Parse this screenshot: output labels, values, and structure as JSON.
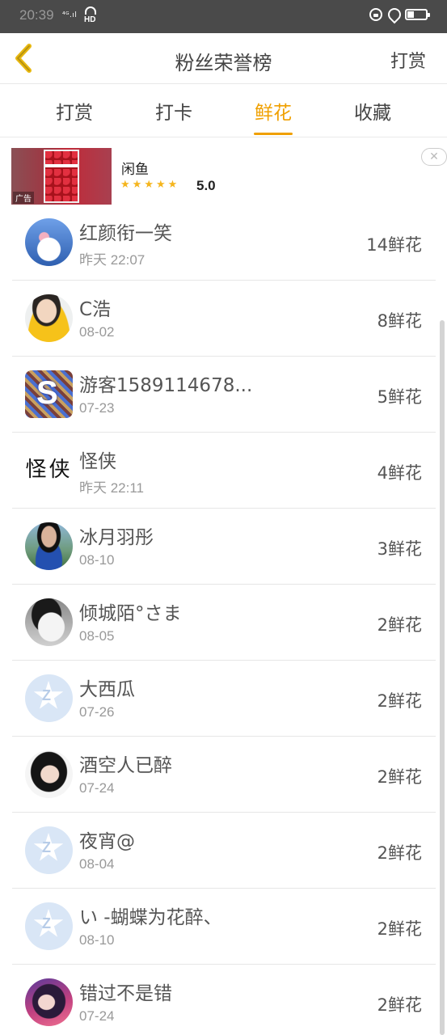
{
  "status_bar": {
    "time": "20:39",
    "signal": "⁴ᴳ.ıl",
    "hd": "HD"
  },
  "header": {
    "title": "粉丝荣誉榜",
    "right_action": "打赏"
  },
  "tabs": [
    {
      "label": "打赏",
      "active": false
    },
    {
      "label": "打卡",
      "active": false
    },
    {
      "label": "鲜花",
      "active": true
    },
    {
      "label": "收藏",
      "active": false
    }
  ],
  "ad": {
    "label": "广告",
    "app_name": "闲鱼",
    "rating": "5.0",
    "stars": 5,
    "close": "✕"
  },
  "fans": [
    {
      "name": "红颜衔一笑",
      "time": "昨天 22:07",
      "count": "14鲜花",
      "avatar": "plush-toy-avatar"
    },
    {
      "name": "C浩",
      "time": "08-02",
      "count": "8鲜花",
      "avatar": "photo-avatar"
    },
    {
      "name": "游客1589114678...",
      "time": "07-23",
      "count": "5鲜花",
      "avatar": "pixel-avatar"
    },
    {
      "name": "怪侠",
      "time": "昨天 22:11",
      "count": "4鲜花",
      "avatar": "calligraphy-avatar",
      "avatar_text": "怪侠"
    },
    {
      "name": "冰月羽彤",
      "time": "08-10",
      "count": "3鲜花",
      "avatar": "photo-avatar"
    },
    {
      "name": "倾城陌°さま",
      "time": "08-05",
      "count": "2鲜花",
      "avatar": "anime-avatar"
    },
    {
      "name": "大西瓜",
      "time": "07-26",
      "count": "2鲜花",
      "avatar": "default-avatar"
    },
    {
      "name": "酒空人已醉",
      "time": "07-24",
      "count": "2鲜花",
      "avatar": "photo-avatar"
    },
    {
      "name": "夜宵@",
      "time": "08-04",
      "count": "2鲜花",
      "avatar": "default-avatar"
    },
    {
      "name": "い -蝴蝶为花醉、",
      "time": "08-10",
      "count": "2鲜花",
      "avatar": "default-avatar"
    },
    {
      "name": "错过不是错",
      "time": "07-24",
      "count": "2鲜花",
      "avatar": "photo-avatar"
    }
  ],
  "colors": {
    "accent": "#f0a000",
    "status_bar": "#4a4a4a",
    "star": "#f5b51d"
  }
}
